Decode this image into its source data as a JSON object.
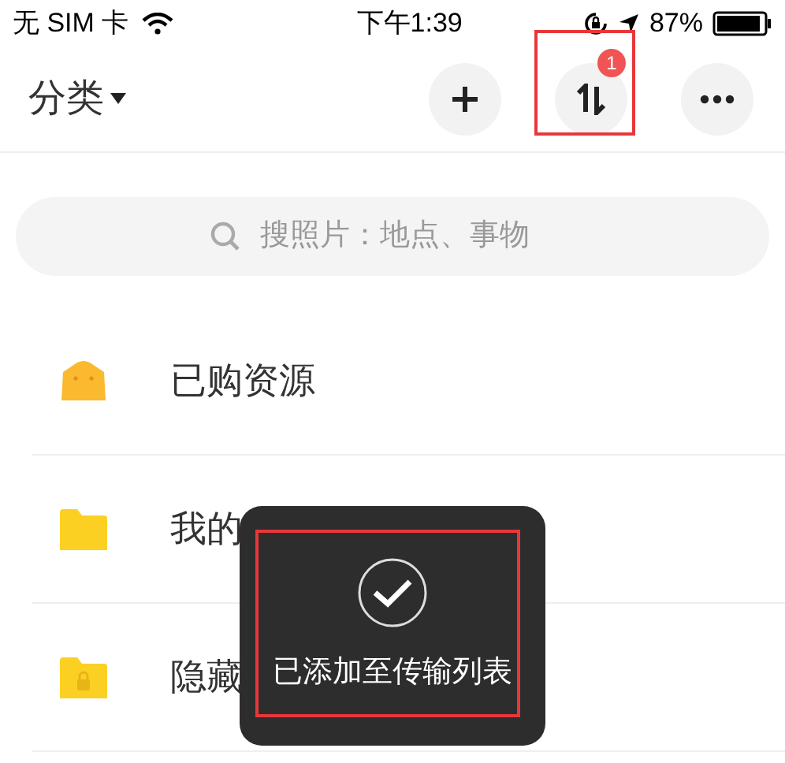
{
  "status_bar": {
    "carrier": "无 SIM 卡",
    "time": "下午1:39",
    "battery": "87%"
  },
  "header": {
    "title": "分类",
    "buttons": [
      {
        "kind": "add",
        "highlighted": false
      },
      {
        "kind": "transfer",
        "badge": "1",
        "highlighted": true
      },
      {
        "kind": "more",
        "highlighted": false
      }
    ]
  },
  "search": {
    "placeholder": "搜照片：地点、事物"
  },
  "items": [
    {
      "name": "已购资源",
      "kind": "bag"
    },
    {
      "name": "我的",
      "kind": "folder"
    },
    {
      "name": "隐藏",
      "kind": "locked_folder"
    }
  ],
  "toast": {
    "message": "已添加至传输列表",
    "highlighted": true
  }
}
